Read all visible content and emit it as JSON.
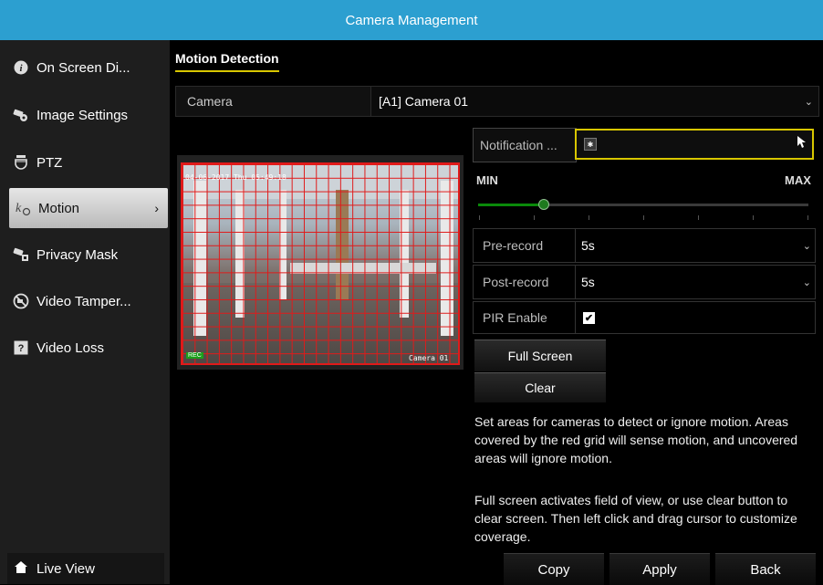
{
  "window": {
    "title": "Camera Management"
  },
  "sidebar": {
    "items": [
      {
        "label": "On Screen Di...",
        "icon": "info-icon"
      },
      {
        "label": "Image Settings",
        "icon": "image-settings-icon"
      },
      {
        "label": "PTZ",
        "icon": "ptz-camera-icon"
      },
      {
        "label": "Motion",
        "icon": "motion-icon",
        "active": true
      },
      {
        "label": "Privacy Mask",
        "icon": "privacy-mask-icon"
      },
      {
        "label": "Video Tamper...",
        "icon": "video-tamper-icon"
      },
      {
        "label": "Video Loss",
        "icon": "video-loss-icon"
      }
    ],
    "live_view": {
      "label": "Live View",
      "icon": "home-icon"
    }
  },
  "main": {
    "tab_label": "Motion Detection",
    "camera": {
      "label": "Camera",
      "value": "[A1] Camera 01"
    },
    "video": {
      "osd_timestamp": "04-06-2017 Thu 05:49:18",
      "osd_camera": "Camera 01",
      "rec_label": "REC"
    },
    "notification": {
      "label": "Notification ..."
    },
    "sensitivity": {
      "min_label": "MIN",
      "max_label": "MAX",
      "level": 0.2
    },
    "pre_record": {
      "label": "Pre-record",
      "value": "5s"
    },
    "post_record": {
      "label": "Post-record",
      "value": "5s"
    },
    "pir": {
      "label": "PIR Enable",
      "checked": true
    },
    "buttons": {
      "full_screen": "Full Screen",
      "clear": "Clear"
    },
    "info_paragraphs": [
      "Set areas for cameras to detect or ignore motion. Areas covered by the red grid will sense motion, and uncovered areas will ignore motion.",
      "Full screen activates field of view, or use clear button to clear screen. Then left click and drag cursor to customize coverage."
    ]
  },
  "footer": {
    "copy": "Copy",
    "apply": "Apply",
    "back": "Back"
  },
  "colors": {
    "titlebar": "#2c9fd0",
    "accent": "#d8c600",
    "grid": "#e01a1a"
  }
}
